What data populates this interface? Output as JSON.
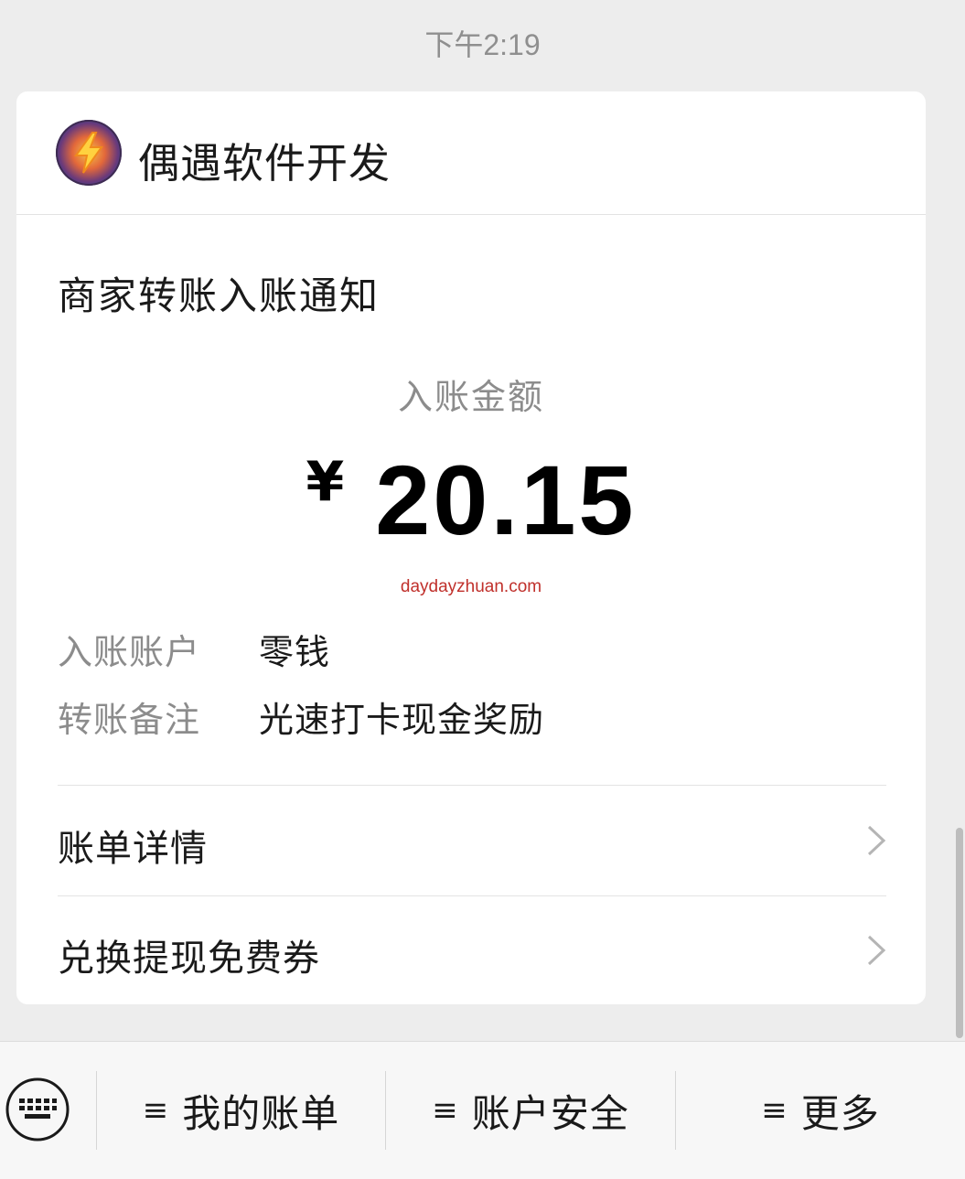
{
  "status": {
    "time": "下午2:19"
  },
  "card": {
    "merchant_name": "偶遇软件开发",
    "notice_title": "商家转账入账通知",
    "amount_label": "入账金额",
    "currency_symbol": "¥",
    "amount": "20.15",
    "watermark": "daydayzhuan.com",
    "details": [
      {
        "key": "入账账户",
        "value": "零钱"
      },
      {
        "key": "转账备注",
        "value": "光速打卡现金奖励"
      }
    ],
    "links": [
      {
        "label": "账单详情"
      },
      {
        "label": "兑换提现免费券"
      }
    ]
  },
  "bottom_menu": {
    "items": [
      {
        "icon": "≡",
        "label": "我的账单"
      },
      {
        "icon": "≡",
        "label": "账户安全"
      },
      {
        "icon": "≡",
        "label": "更多"
      }
    ]
  },
  "colors": {
    "background": "#ededed",
    "card": "#ffffff",
    "watermark": "#c0302b",
    "muted_text": "#8c8c8c"
  },
  "icons": {
    "avatar": "lightning-avatar-icon",
    "chevron": "chevron-right-icon",
    "keyboard": "keyboard-icon"
  }
}
